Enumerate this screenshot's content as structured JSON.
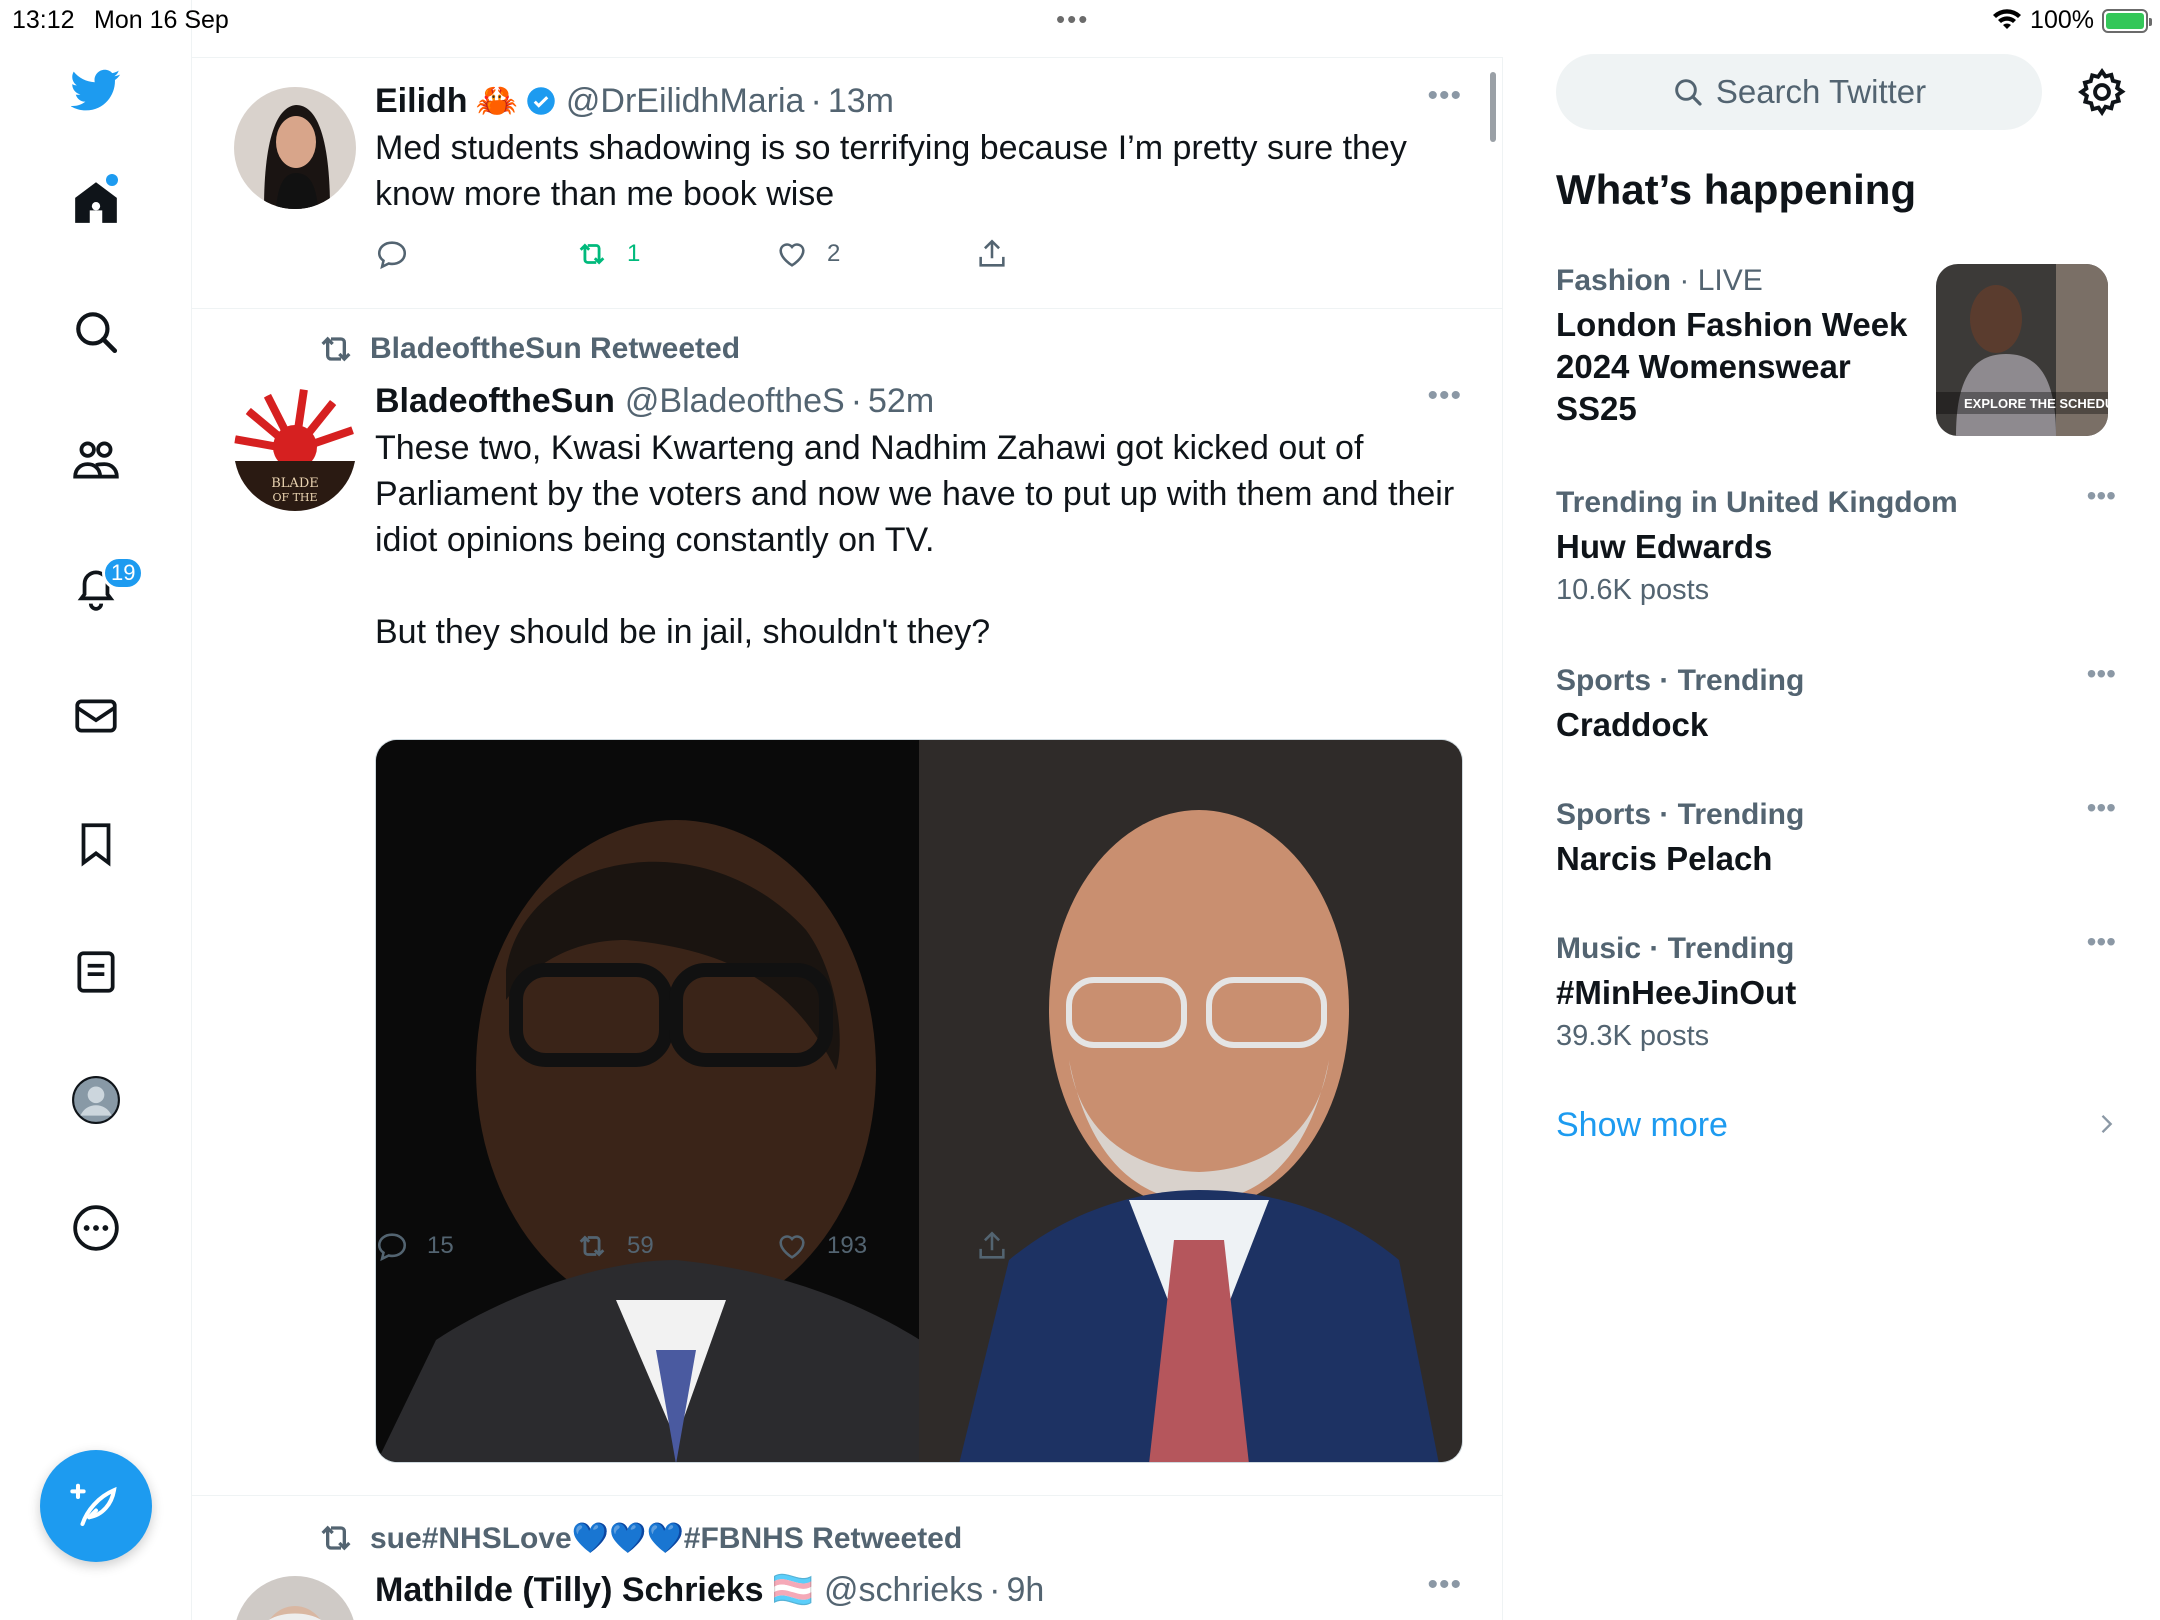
{
  "status_bar": {
    "time": "13:12",
    "date": "Mon 16 Sep",
    "battery": "100%"
  },
  "nav": {
    "notifications_count": "19"
  },
  "tweets": [
    {
      "name": "Eilidh",
      "emoji": "🦀",
      "handle": "@DrEilidhMaria",
      "time": "13m",
      "text": "Med students shadowing is so terrifying because I’m pretty sure they\nknow more than me book wise",
      "replies": "",
      "retweets": "1",
      "likes": "2"
    },
    {
      "retweeted_by": "BladeoftheSun Retweeted",
      "name": "BladeoftheSun",
      "handle": "@BladeoftheS",
      "time": "52m",
      "text": "These two, Kwasi Kwarteng and Nadhim Zahawi got kicked out of\nParliament by the voters and now we have to put up with them and their\nidiot opinions being constantly on TV.\n\nBut they should be in jail, shouldn't they?",
      "replies": "15",
      "retweets": "59",
      "likes": "193"
    },
    {
      "retweeted_by": "sue#NHSLove💙💙💙#FBNHS Retweeted",
      "name": "Mathilde (Tilly) Schrieks",
      "flag": "🏳️‍⚧️",
      "handle": "@schrieks",
      "time": "9h"
    }
  ],
  "sidebar": {
    "search_placeholder": "Search Twitter",
    "title": "What’s happening",
    "trends": [
      {
        "category": "Fashion",
        "extra": "LIVE",
        "name": "London Fashion Week 2024 Womenswear SS25",
        "count": "",
        "image_text": "EXPLORE THE SCHEDUL"
      },
      {
        "category": "Trending in United Kingdom",
        "extra": "",
        "name": "Huw Edwards",
        "count": "10.6K posts"
      },
      {
        "category": "Sports · Trending",
        "extra": "",
        "name": "Craddock",
        "count": ""
      },
      {
        "category": "Sports · Trending",
        "extra": "",
        "name": "Narcis Pelach",
        "count": ""
      },
      {
        "category": "Music · Trending",
        "extra": "",
        "name": "#MinHeeJinOut",
        "count": "39.3K posts"
      }
    ],
    "show_more": "Show more"
  },
  "colors": {
    "accent": "#1d9bf0",
    "retweet_green": "#00ba7c",
    "muted": "#536471"
  }
}
